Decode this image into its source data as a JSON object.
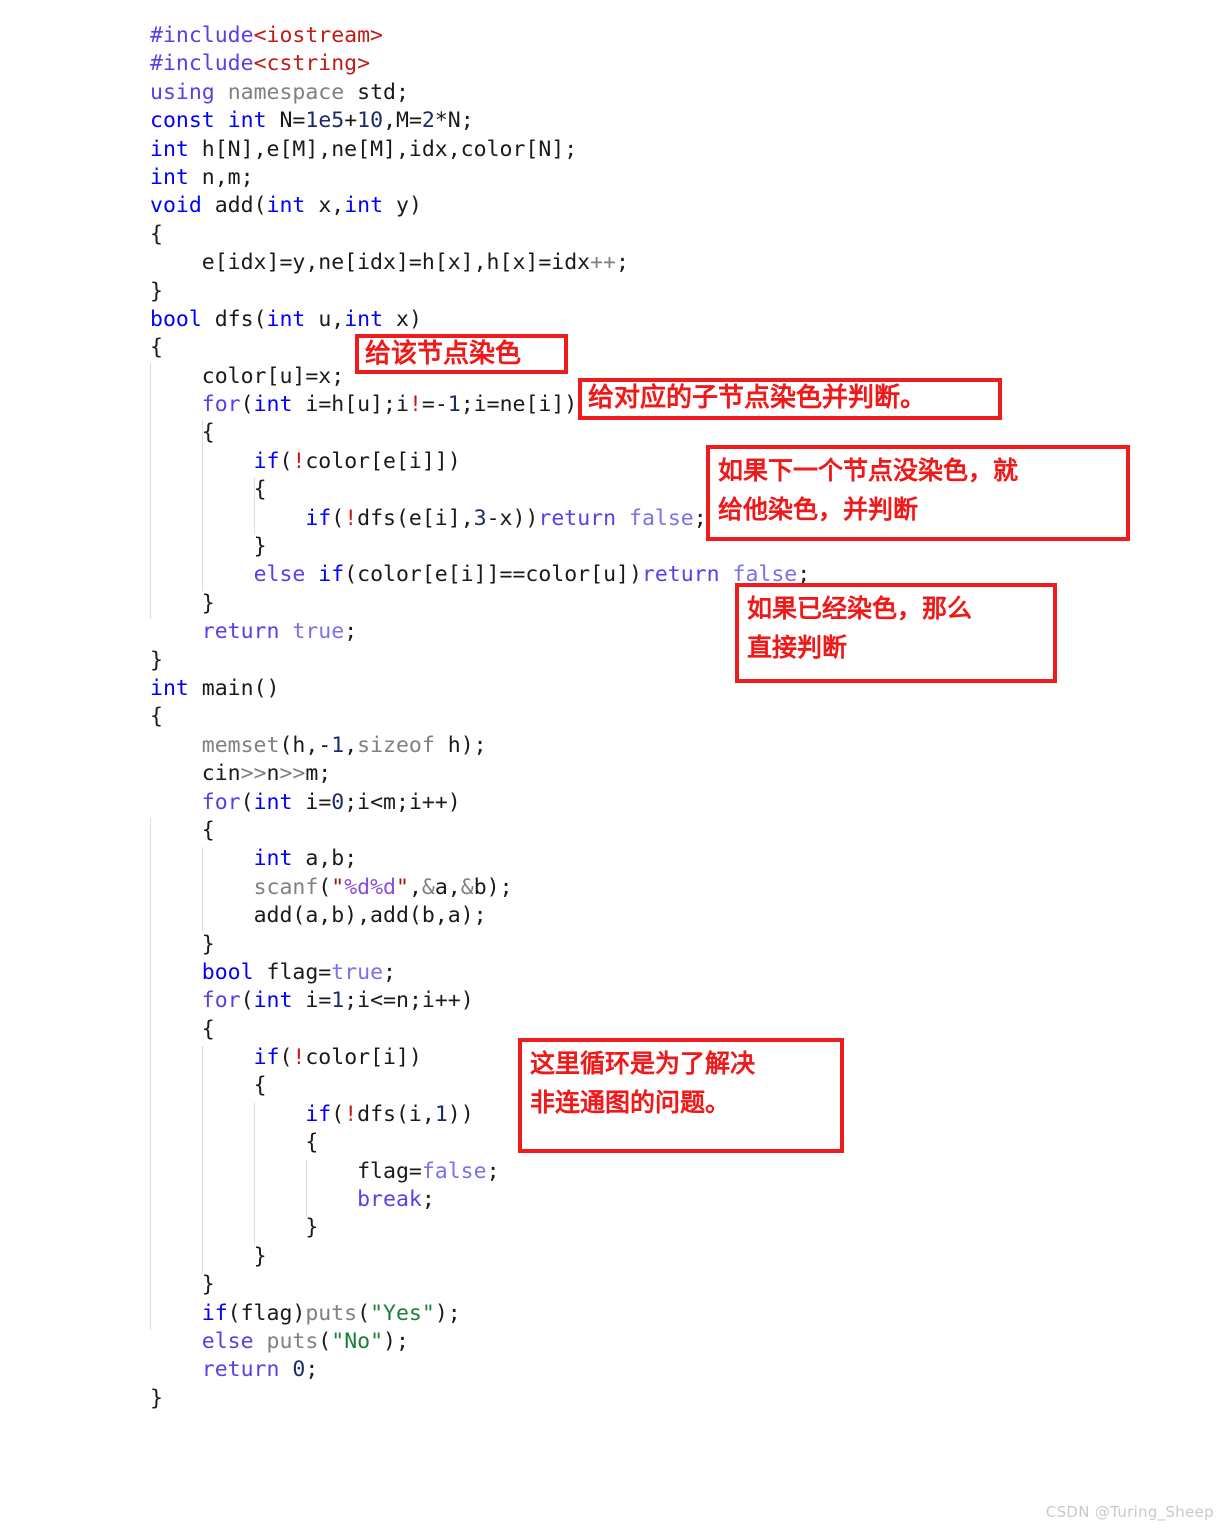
{
  "document": {
    "kind": "code-screenshot",
    "language": "C++",
    "watermark": "CSDN @Turing_Sheep"
  },
  "colors": {
    "background": "#ffffff",
    "text": "#1a1a1a",
    "keyword_blue": "#0000ff",
    "keyword_violet": "#5b3ee8",
    "header_red": "#c41a16",
    "gray_identifier": "#808080",
    "number": "#1b2a6b",
    "bool_literal": "#7a72e6",
    "string_green": "#1a7f37",
    "annotation_red": "#f01818",
    "annotation_border": "#ee1c1c",
    "indent_guide": "#dcdcdc",
    "watermark": "#c9c9c9"
  },
  "code": {
    "lines": [
      "#include<iostream>",
      "#include<cstring>",
      "using namespace std;",
      "const int N=1e5+10,M=2*N;",
      "int h[N],e[M],ne[M],idx,color[N];",
      "int n,m;",
      "void add(int x,int y)",
      "{",
      "    e[idx]=y,ne[idx]=h[x],h[x]=idx++;",
      "}",
      "bool dfs(int u,int x)",
      "{",
      "    color[u]=x;",
      "    for(int i=h[u];i!=-1;i=ne[i])",
      "    {",
      "        if(!color[e[i]])",
      "        {",
      "            if(!dfs(e[i],3-x))return false;",
      "        }",
      "        else if(color[e[i]]==color[u])return false;",
      "    }",
      "    return true;",
      "}",
      "int main()",
      "{",
      "    memset(h,-1,sizeof h);",
      "    cin>>n>>m;",
      "    for(int i=0;i<m;i++)",
      "    {",
      "        int a,b;",
      "        scanf(\"%d%d\",&a,&b);",
      "        add(a,b),add(b,a);",
      "    }",
      "    bool flag=true;",
      "    for(int i=1;i<=n;i++)",
      "    {",
      "        if(!color[i])",
      "        {",
      "            if(!dfs(i,1))",
      "            {",
      "                flag=false;",
      "                break;",
      "            }",
      "        }",
      "    }",
      "    if(flag)puts(\"Yes\");",
      "    else puts(\"No\");",
      "    return 0;",
      "}"
    ]
  },
  "annotations": [
    {
      "id": "note-color-node",
      "text": "给该节点染色",
      "target_line": "color[u]=x;",
      "meaning_en": "Color this node"
    },
    {
      "id": "note-child-node",
      "text": "给对应的子节点染色并判断。",
      "target_line": "for(int i=h[u];i!=-1;i=ne[i])",
      "meaning_en": "Color the corresponding child nodes and check."
    },
    {
      "id": "note-uncolored",
      "text": "如果下一个节点没染色，就\n给他染色，并判断",
      "target_line": "if(!dfs(e[i],3-x))return false;",
      "meaning_en": "If the next node is not colored, color it and check"
    },
    {
      "id": "note-already",
      "text": "如果已经染色，那么\n直接判断",
      "target_line": "else if(color[e[i]]==color[u])return false;",
      "meaning_en": "If already colored, then check directly"
    },
    {
      "id": "note-loop",
      "text": "这里循环是为了解决\n非连通图的问题。",
      "target_line": "for(int i=1;i<=n;i++)",
      "meaning_en": "This loop is to handle the disconnected-graph case."
    }
  ]
}
